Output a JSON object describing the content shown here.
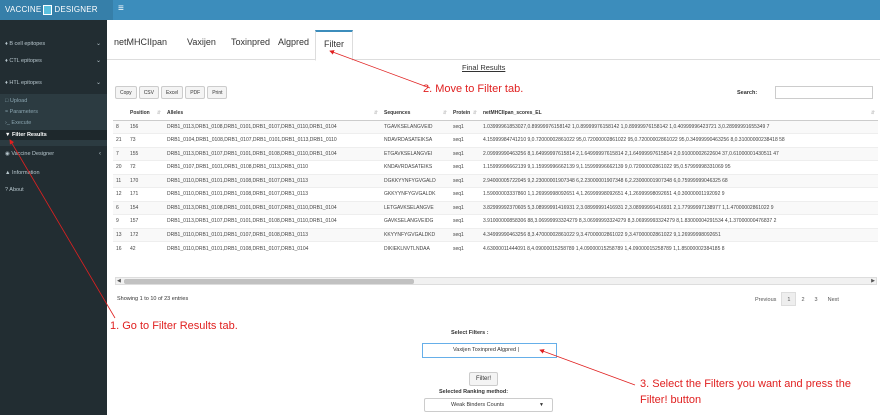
{
  "app": {
    "title_left": "VACCINE",
    "title_right": "DESIGNER",
    "menu_icon": "hamburger-icon"
  },
  "sidebar": {
    "items": [
      {
        "label": "B cell epitopes",
        "icon": "tag-icon"
      },
      {
        "label": "CTL epitopes",
        "icon": "tag-icon"
      },
      {
        "label": "HTL epitopes",
        "icon": "tag-icon"
      },
      {
        "label": "Upload",
        "icon": "file-icon"
      },
      {
        "label": "Parameters",
        "icon": "sliders-icon"
      },
      {
        "label": "Execute",
        "icon": "terminal-icon"
      },
      {
        "label": "Filter Results",
        "icon": "filter-icon"
      },
      {
        "label": "Vaccine Designer",
        "icon": "shield-icon"
      },
      {
        "label": "Information",
        "icon": "graduation-cap-icon"
      },
      {
        "label": "About",
        "icon": "question-icon"
      }
    ]
  },
  "tabs": [
    {
      "label": "netMHCIIpan"
    },
    {
      "label": "Vaxijen"
    },
    {
      "label": "Toxinpred"
    },
    {
      "label": "Algpred"
    },
    {
      "label": "Filter"
    }
  ],
  "results": {
    "title": "Final Results",
    "buttons": [
      "Copy",
      "CSV",
      "Excel",
      "PDF",
      "Print"
    ],
    "search_label": "Search:",
    "columns": [
      "",
      "Position",
      "Alleles",
      "Sequences",
      "Protein",
      "netMHCIIpan_scores_EL"
    ],
    "rows": [
      [
        "8",
        "156",
        "DRB1_0113,DRB1_0108,DRB1_0101,DRB1_0107,DRB1_0110,DRB1_0104",
        "TGAVKSELANGVEID",
        "seq1",
        "1.03999961853027,0.89999976158142 1,0.89999976158142 1,0.89999976158142 1,0.40999996423721 3,0.28999991655349 7"
      ],
      [
        "21",
        "73",
        "DRB1_0104,DRB1_0108,DRB1_0107,DRB1_0101,DRB1_0113,DRB1_0110",
        "NDAVRDASATEIKSA",
        "seq1",
        "4.15999984741210 9,0.72000002861022 95,0.72000002861022 95,0.72000002861022 95,0.34999990463256 8,0.31000000238418 58"
      ],
      [
        "7",
        "155",
        "DRB1_0113,DRB1_0107,DRB1_0101,DRB1_0108,DRB1_0110,DRB1_0104",
        "ETGAVKSELANGVEI",
        "seq1",
        "2.09999990463256 8,1.64999997615814 2,1.64999997615814 2,1.64999997615814 2,0.91000002622604 37,0.61000001430511 47"
      ],
      [
        "20",
        "72",
        "DRB1_0107,DRB1_0101,DRB1_0108,DRB1_0113,DRB1_0110",
        "KNDAVRDASATEIKS",
        "seq1",
        "1.15999996662139 9,1.15999996662139 9,1.15999996662139 9,0.72000002861022 95,0.57999998331069 95"
      ],
      [
        "11",
        "170",
        "DRB1_0110,DRB1_0101,DRB1_0108,DRB1_0107,DRB1_0113",
        "DGKKYYNFYGVGALD",
        "seq1",
        "2.94000005722045 9,2.23000001907348 6,2.23000001907348 6,2.23000001907348 6,0.75999999046325 68"
      ],
      [
        "12",
        "171",
        "DRB1_0110,DRB1_0101,DRB1_0108,DRB1_0107,DRB1_0113",
        "GKKYYNFYGVGALDK",
        "seq1",
        "1.59000003337860 1,1.26999998092651 4,1.26999998092651 4,1.26999998092651 4,0.30000001192092 9"
      ],
      [
        "6",
        "154",
        "DRB1_0113,DRB1_0108,DRB1_0101,DRB1_0107,DRB1_0110,DRB1_0104",
        "LETGAVKSELANGVE",
        "seq1",
        "3.82999992370605 5,3.08999991416931 2,3.08999991416931 2,3.08999991416931 2,1.77999997138977 1,1.47000002861022 9"
      ],
      [
        "9",
        "157",
        "DRB1_0113,DRB1_0107,DRB1_0101,DRB1_0108,DRB1_0110,DRB1_0104",
        "GAVKSELANGVEIDG",
        "seq1",
        "3.91000000858306 88,3.06999993324279 8,3.06999993324279 8,3.06999993324279 8,1.83000004291534 4,1.37000000476837 2"
      ],
      [
        "13",
        "172",
        "DRB1_0110,DRB1_0101,DRB1_0107,DRB1_0108,DRB1_0113",
        "KKYYNFYGVGALDKD",
        "seq1",
        "4.34999990463256 8,3.47000002861022 9,3.47000002861022 9,3.47000002861022 9,1.26999998092651"
      ],
      [
        "16",
        "42",
        "DRB1_0110,DRB1_0101,DRB1_0108,DRB1_0107,DRB1_0104",
        "DIKIEKLNVTLNDAA",
        "seq1",
        "4.63000011444091 8,4.09000015258789 1,4.09000015258789 1,4.09000015258789 1,1.85000002384185 8"
      ]
    ],
    "showing": "Showing 1 to 10 of 23 entries",
    "pager": [
      "Previous",
      "1",
      "2",
      "3",
      "Next"
    ]
  },
  "filters": {
    "select_label": "Select Filters :",
    "selected_value": "Vaxijen  Toxinpred  Algpred |",
    "filter_button": "Filter!",
    "ranking_label": "Selected Ranking method:",
    "ranking_value": "Weak Binders Counts"
  },
  "annotations": {
    "step1": "1. Go to Filter Results tab.",
    "step2": "2. Move to Filter tab.",
    "step3_line1": "3. Select the Filters you want and press the",
    "step3_line2": "Filter! button",
    "color": "#e02020"
  }
}
